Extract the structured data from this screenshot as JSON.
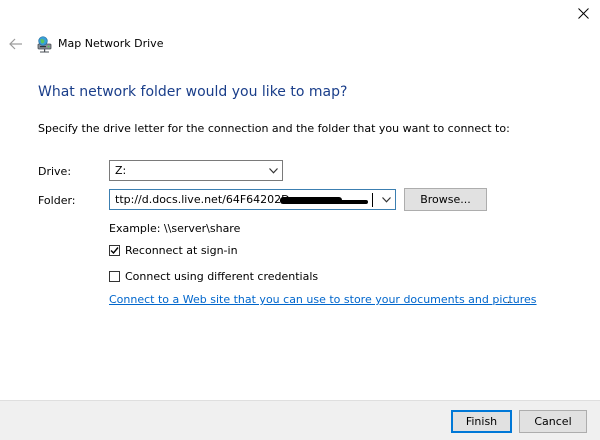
{
  "window": {
    "title": "Map Network Drive",
    "accent_color": "#0078d7",
    "heading_color": "#1a3e8a",
    "link_color": "#0066cc"
  },
  "icons": {
    "close": "close-icon",
    "back": "back-arrow-icon",
    "title": "network-drive-icon",
    "dropdown": "chevron-down-icon",
    "check": "checkmark-icon"
  },
  "content": {
    "heading": "What network folder would you like to map?",
    "instruction": "Specify the drive letter for the connection and the folder that you want to connect to:",
    "drive_label": "Drive:",
    "drive_value": "Z:",
    "folder_label": "Folder:",
    "folder_value": "ttp://d.docs.live.net/64F64202D",
    "browse_label": "Browse...",
    "example": "Example: \\\\server\\share",
    "reconnect_label": "Reconnect at sign-in",
    "reconnect_checked": true,
    "credentials_label": "Connect using different credentials",
    "credentials_checked": false,
    "link_text": "Connect to a Web site that you can use to store your documents and pictures",
    "link_suffix": "."
  },
  "footer": {
    "finish_label": "Finish",
    "cancel_label": "Cancel"
  }
}
